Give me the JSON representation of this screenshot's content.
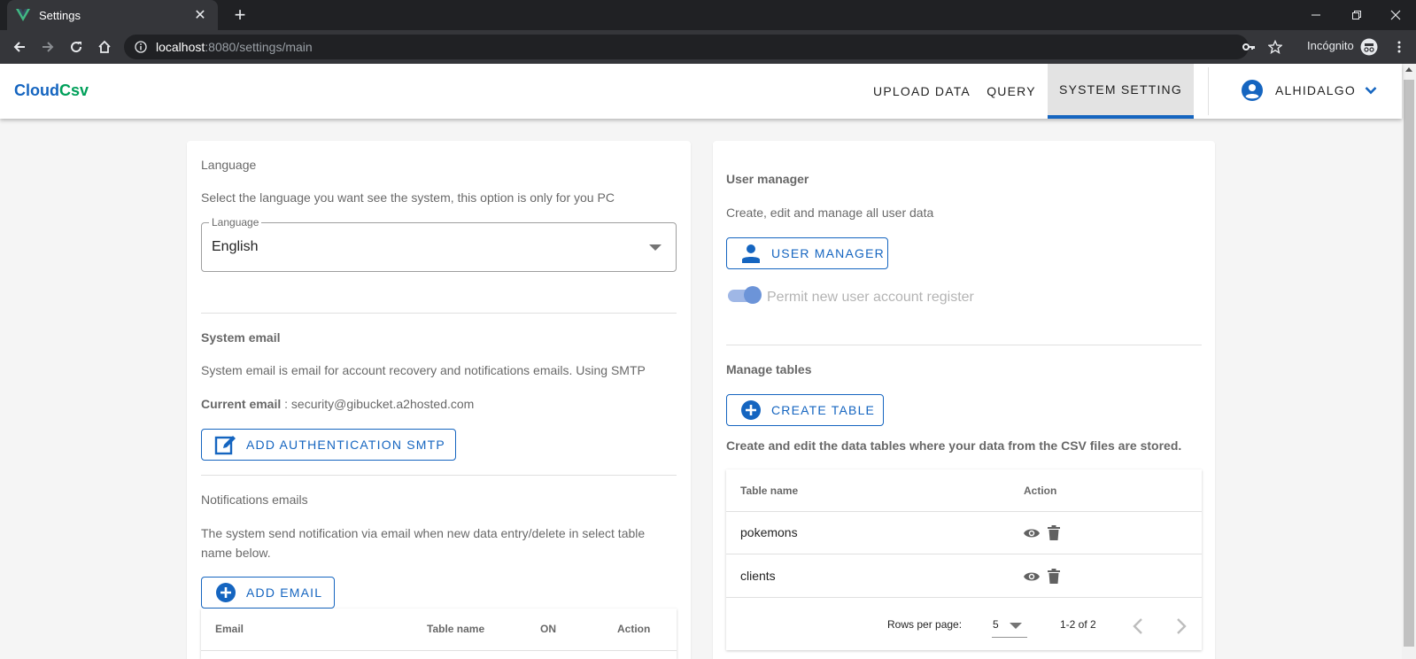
{
  "browser": {
    "tab_title": "Settings",
    "url_host": "localhost",
    "url_rest": ":8080/settings/main",
    "incognito_label": "Incógnito"
  },
  "appbar": {
    "logo_part1": "Cloud",
    "logo_part2": "Csv",
    "nav": [
      {
        "label": "UPLOAD DATA"
      },
      {
        "label": "QUERY"
      },
      {
        "label": "SYSTEM SETTING",
        "active": true
      }
    ],
    "user_name": "ALHIDALGO"
  },
  "language_section": {
    "title": "Language",
    "description": "Select the language you want see the system, this option is only for you PC",
    "select_label": "Language",
    "select_value": "English"
  },
  "email_section": {
    "title": "System email",
    "description": "System email is email for account recovery and notifications emails. Using SMTP",
    "current_label": "Current email",
    "current_value": " : security@gibucket.a2hosted.com",
    "button_label": "ADD AUTHENTICATION SMTP"
  },
  "notifications_section": {
    "title": "Notifications emails",
    "description_line1": "The system send notification via email when new data entry/delete in select table",
    "description_line2": "name below.",
    "button_label": "ADD EMAIL",
    "columns": [
      "Email",
      "Table name",
      "ON",
      "Action"
    ]
  },
  "user_manager_section": {
    "title": "User manager",
    "description": "Create, edit and manage all user data",
    "button_label": "USER MANAGER",
    "toggle_label": "Permit new user account register"
  },
  "tables_section": {
    "title": "Manage tables",
    "button_label": "CREATE TABLE",
    "description": "Create and edit the data tables where your data from the CSV files are stored.",
    "columns": [
      "Table name",
      "Action"
    ],
    "rows": [
      {
        "name": "pokemons"
      },
      {
        "name": "clients"
      }
    ],
    "rows_per_page_label": "Rows per page:",
    "rows_per_page_value": "5",
    "pagination": "1-2 of 2"
  }
}
